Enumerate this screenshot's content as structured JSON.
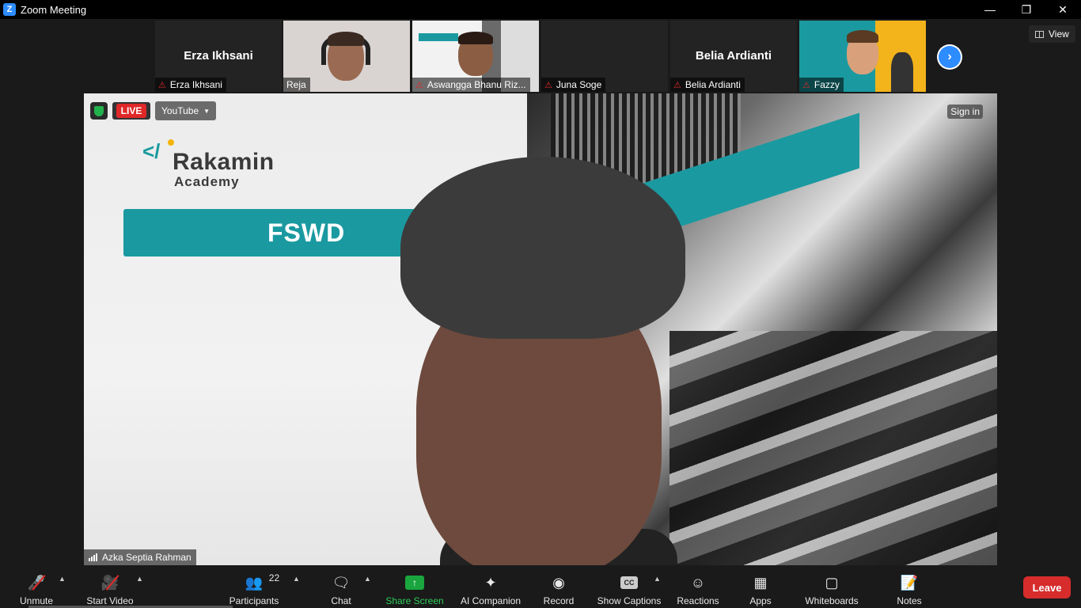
{
  "window": {
    "title": "Zoom Meeting",
    "app_icon": "Z",
    "controls": [
      "minimize-icon",
      "restore-icon",
      "close-icon"
    ]
  },
  "strip": {
    "participants": [
      {
        "big_name": "Erza Ikhsani",
        "label": "Erza Ikhsani",
        "muted": true,
        "video": false
      },
      {
        "big_name": "",
        "label": "Reja",
        "muted": false,
        "video": true
      },
      {
        "big_name": "",
        "label": "Aswangga Bhanu Riz...",
        "muted": true,
        "video": true
      },
      {
        "big_name": "",
        "label": "Juna Soge",
        "muted": true,
        "video": false
      },
      {
        "big_name": "Belia Ardianti",
        "label": "Belia Ardianti",
        "muted": true,
        "video": false
      },
      {
        "big_name": "",
        "label": "Fazzy",
        "muted": true,
        "video": true
      }
    ],
    "next_icon": "chevron-right-icon",
    "view_label": "View"
  },
  "main": {
    "live_label": "LIVE",
    "stream_target": "YouTube",
    "sign_in": "Sign in",
    "speaker_name": "Azka Septia Rahman",
    "slide": {
      "logo_text": "Rakamin",
      "logo_sub": "Academy",
      "banner": "FSWD"
    }
  },
  "toolbar": {
    "unmute": "Unmute",
    "start_video": "Start Video",
    "participants": "Participants",
    "participants_count": "22",
    "chat": "Chat",
    "share_screen": "Share Screen",
    "ai_companion": "AI Companion",
    "record": "Record",
    "show_captions": "Show Captions",
    "cc_icon_text": "CC",
    "reactions": "Reactions",
    "apps": "Apps",
    "whiteboards": "Whiteboards",
    "notes": "Notes",
    "leave": "Leave"
  },
  "colors": {
    "accent": "#2d8cff",
    "leave": "#d62c2c",
    "share": "#1aa53e",
    "muted": "#e02828",
    "brand_teal": "#1a9aa0"
  }
}
